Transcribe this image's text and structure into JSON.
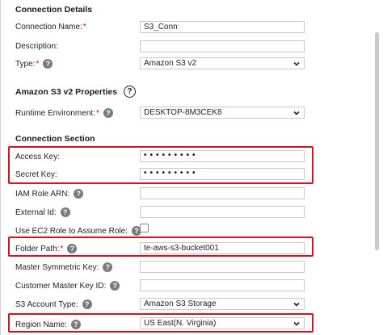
{
  "sections": {
    "connection_details": "Connection Details",
    "s3_properties": "Amazon S3 v2 Properties",
    "connection_section": "Connection Section"
  },
  "fields": {
    "connection_name": {
      "label": "Connection Name:",
      "required": "*",
      "value": "S3_Conn"
    },
    "description": {
      "label": "Description:",
      "value": ""
    },
    "type": {
      "label": "Type:",
      "required": "*",
      "value": "Amazon S3 v2"
    },
    "runtime_env": {
      "label": "Runtime Environment:",
      "required": "*",
      "value": "DESKTOP-8M3CEK8"
    },
    "access_key": {
      "label": "Access Key:",
      "value": "•••••••••"
    },
    "secret_key": {
      "label": "Secret Key:",
      "value": "•••••••••"
    },
    "iam_role_arn": {
      "label": "IAM Role ARN:",
      "value": ""
    },
    "external_id": {
      "label": "External Id:",
      "value": ""
    },
    "use_ec2_role": {
      "label": "Use EC2 Role to Assume Role:",
      "checked": false
    },
    "folder_path": {
      "label": "Folder Path:",
      "required": "*",
      "value": "te-aws-s3-bucket001"
    },
    "master_symmetric_key": {
      "label": "Master Symmetric Key:",
      "value": ""
    },
    "customer_master_key_id": {
      "label": "Customer Master Key ID:",
      "value": ""
    },
    "s3_account_type": {
      "label": "S3 Account Type:",
      "value": "Amazon S3 Storage"
    },
    "region_name": {
      "label": "Region Name:",
      "value": "US East(N. Virginia)"
    }
  },
  "icons": {
    "help": "?",
    "help_circle": "?"
  },
  "colors": {
    "highlight": "#d4121f",
    "required": "#d0021b"
  }
}
